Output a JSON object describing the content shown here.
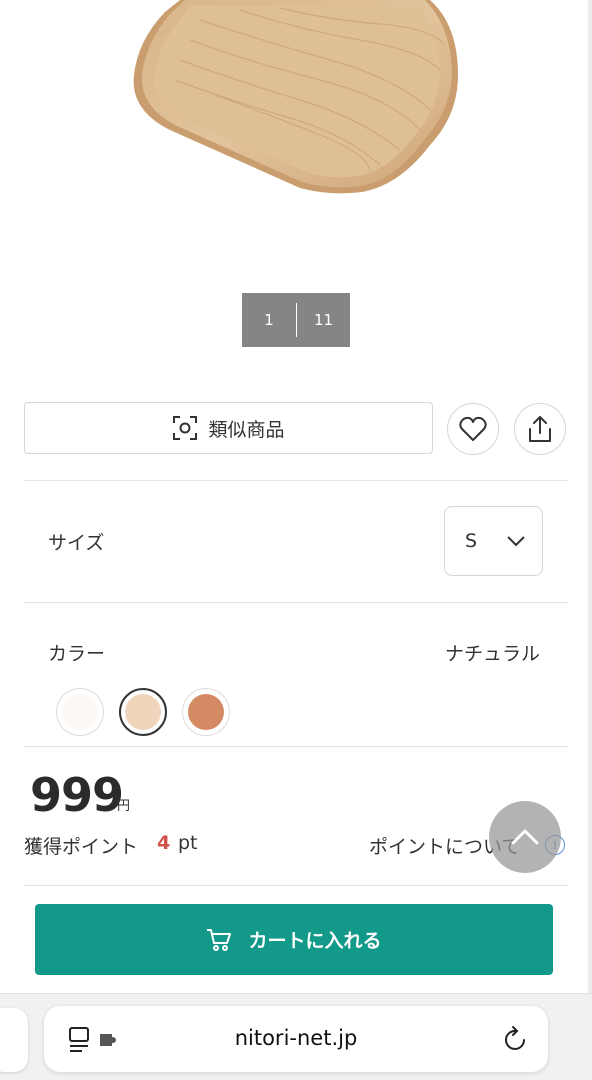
{
  "product": {
    "image_icon": "wooden-tray-image",
    "pager": {
      "current": "1",
      "total": "11"
    }
  },
  "actions": {
    "similar_label": "類似商品",
    "similar_icon": "visual-search-icon",
    "favorite_icon": "heart-icon",
    "share_icon": "share-icon"
  },
  "size": {
    "label": "サイズ",
    "selected": "S",
    "dropdown_icon": "chevron-down-icon"
  },
  "color": {
    "label": "カラー",
    "selected_name": "ナチュラル",
    "swatches": [
      "#fdf7f5",
      "#f0d5bd",
      "#d48a63"
    ],
    "selected_index": 1
  },
  "price": {
    "value": "999",
    "unit": "円"
  },
  "points": {
    "label": "獲得ポイント",
    "value": "4",
    "unit": "pt",
    "about_link": "ポイントについて",
    "info_icon": "info-icon"
  },
  "scroll_top_icon": "chevron-up-icon",
  "cart": {
    "label": "カートに入れる",
    "icon": "cart-icon",
    "color": "#12998a"
  },
  "browser": {
    "url": "nitori-net.jp",
    "reader_icon": "reader-mode-icon",
    "reload_icon": "reload-icon"
  }
}
